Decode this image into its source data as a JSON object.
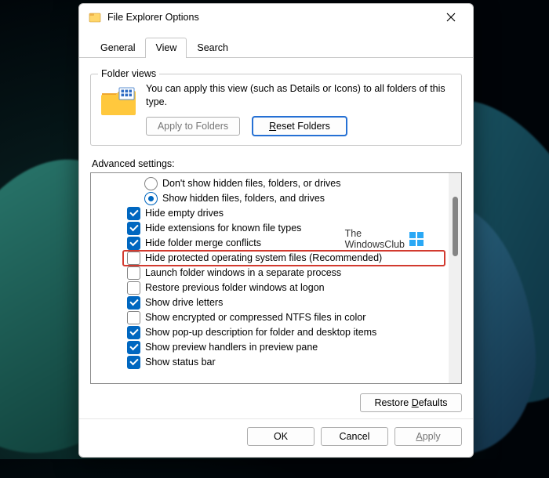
{
  "window": {
    "title": "File Explorer Options"
  },
  "tabs": {
    "general": "General",
    "view": "View",
    "search": "Search",
    "active": "view"
  },
  "folder_views": {
    "group_title": "Folder views",
    "description": "You can apply this view (such as Details or Icons) to all folders of this type.",
    "apply_btn": "Apply to Folders",
    "reset_btn": "Reset Folders"
  },
  "advanced": {
    "label": "Advanced settings:",
    "items": [
      {
        "kind": "radio",
        "indent": 2,
        "checked": false,
        "highlight": false,
        "label": "Don't show hidden files, folders, or drives"
      },
      {
        "kind": "radio",
        "indent": 2,
        "checked": true,
        "highlight": false,
        "label": "Show hidden files, folders, and drives"
      },
      {
        "kind": "checkbox",
        "indent": 1,
        "checked": true,
        "highlight": false,
        "label": "Hide empty drives"
      },
      {
        "kind": "checkbox",
        "indent": 1,
        "checked": true,
        "highlight": false,
        "label": "Hide extensions for known file types"
      },
      {
        "kind": "checkbox",
        "indent": 1,
        "checked": true,
        "highlight": false,
        "label": "Hide folder merge conflicts"
      },
      {
        "kind": "checkbox",
        "indent": 1,
        "checked": false,
        "highlight": true,
        "label": "Hide protected operating system files (Recommended)"
      },
      {
        "kind": "checkbox",
        "indent": 1,
        "checked": false,
        "highlight": false,
        "label": "Launch folder windows in a separate process"
      },
      {
        "kind": "checkbox",
        "indent": 1,
        "checked": false,
        "highlight": false,
        "label": "Restore previous folder windows at logon"
      },
      {
        "kind": "checkbox",
        "indent": 1,
        "checked": true,
        "highlight": false,
        "label": "Show drive letters"
      },
      {
        "kind": "checkbox",
        "indent": 1,
        "checked": false,
        "highlight": false,
        "label": "Show encrypted or compressed NTFS files in color"
      },
      {
        "kind": "checkbox",
        "indent": 1,
        "checked": true,
        "highlight": false,
        "label": "Show pop-up description for folder and desktop items"
      },
      {
        "kind": "checkbox",
        "indent": 1,
        "checked": true,
        "highlight": false,
        "label": "Show preview handlers in preview pane"
      },
      {
        "kind": "checkbox",
        "indent": 1,
        "checked": true,
        "highlight": false,
        "label": "Show status bar"
      }
    ]
  },
  "watermark": {
    "line1": "The",
    "line2": "WindowsClub"
  },
  "buttons": {
    "restore_defaults": "Restore Defaults",
    "ok": "OK",
    "cancel": "Cancel",
    "apply": "Apply"
  }
}
